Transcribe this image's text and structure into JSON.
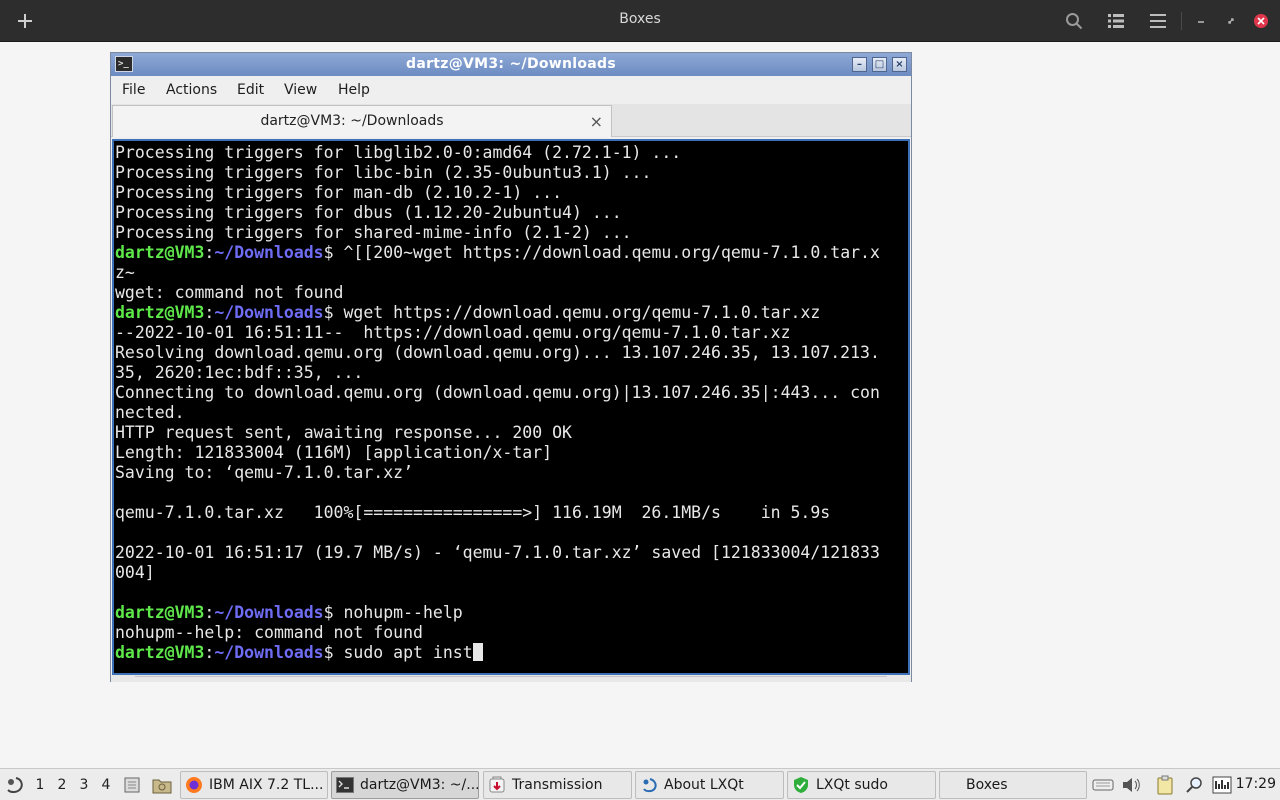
{
  "app": {
    "title": "Boxes"
  },
  "terminal": {
    "window_title": "dartz@VM3: ~/Downloads",
    "menu": [
      "File",
      "Actions",
      "Edit",
      "View",
      "Help"
    ],
    "tab_label": "dartz@VM3: ~/Downloads",
    "prompt": {
      "user_host": "dartz@VM3",
      "sep": ":",
      "path": "~/Downloads",
      "dollar": "$ "
    },
    "lines": [
      {
        "text": "Processing triggers for libglib2.0-0:amd64 (2.72.1-1) ..."
      },
      {
        "text": "Processing triggers for libc-bin (2.35-0ubuntu3.1) ..."
      },
      {
        "text": "Processing triggers for man-db (2.10.2-1) ..."
      },
      {
        "text": "Processing triggers for dbus (1.12.20-2ubuntu4) ..."
      },
      {
        "text": "Processing triggers for shared-mime-info (2.1-2) ..."
      },
      {
        "prompt": true,
        "text": "^[[200~wget https://download.qemu.org/qemu-7.1.0.tar.x"
      },
      {
        "text": "z~"
      },
      {
        "text": "wget: command not found"
      },
      {
        "prompt": true,
        "text": "wget https://download.qemu.org/qemu-7.1.0.tar.xz"
      },
      {
        "text": "--2022-10-01 16:51:11--  https://download.qemu.org/qemu-7.1.0.tar.xz"
      },
      {
        "text": "Resolving download.qemu.org (download.qemu.org)... 13.107.246.35, 13.107.213."
      },
      {
        "text": "35, 2620:1ec:bdf::35, ..."
      },
      {
        "text": "Connecting to download.qemu.org (download.qemu.org)|13.107.246.35|:443... con"
      },
      {
        "text": "nected."
      },
      {
        "text": "HTTP request sent, awaiting response... 200 OK"
      },
      {
        "text": "Length: 121833004 (116M) [application/x-tar]"
      },
      {
        "text": "Saving to: ‘qemu-7.1.0.tar.xz’"
      },
      {
        "text": ""
      },
      {
        "text": "qemu-7.1.0.tar.xz   100%[================>] 116.19M  26.1MB/s    in 5.9s"
      },
      {
        "text": ""
      },
      {
        "text": "2022-10-01 16:51:17 (19.7 MB/s) - ‘qemu-7.1.0.tar.xz’ saved [121833004/121833"
      },
      {
        "text": "004]"
      },
      {
        "text": ""
      },
      {
        "prompt": true,
        "text": "nohupm--help"
      },
      {
        "text": "nohupm--help: command not found"
      },
      {
        "prompt": true,
        "text": "sudo apt inst",
        "cursor": true
      }
    ]
  },
  "taskbar": {
    "desktops": [
      "1",
      "2",
      "3",
      "4"
    ],
    "tasks": [
      {
        "label": "IBM AIX 7.2 TL...",
        "icon": "firefox-icon"
      },
      {
        "label": "dartz@VM3: ~/...",
        "icon": "terminal-icon"
      },
      {
        "label": "Transmission",
        "icon": "transmission-icon"
      },
      {
        "label": "About LXQt",
        "icon": "lxqt-icon"
      },
      {
        "label": "LXQt sudo",
        "icon": "shield-icon"
      },
      {
        "label": "Boxes",
        "icon": ""
      }
    ],
    "clock": "17:29"
  }
}
